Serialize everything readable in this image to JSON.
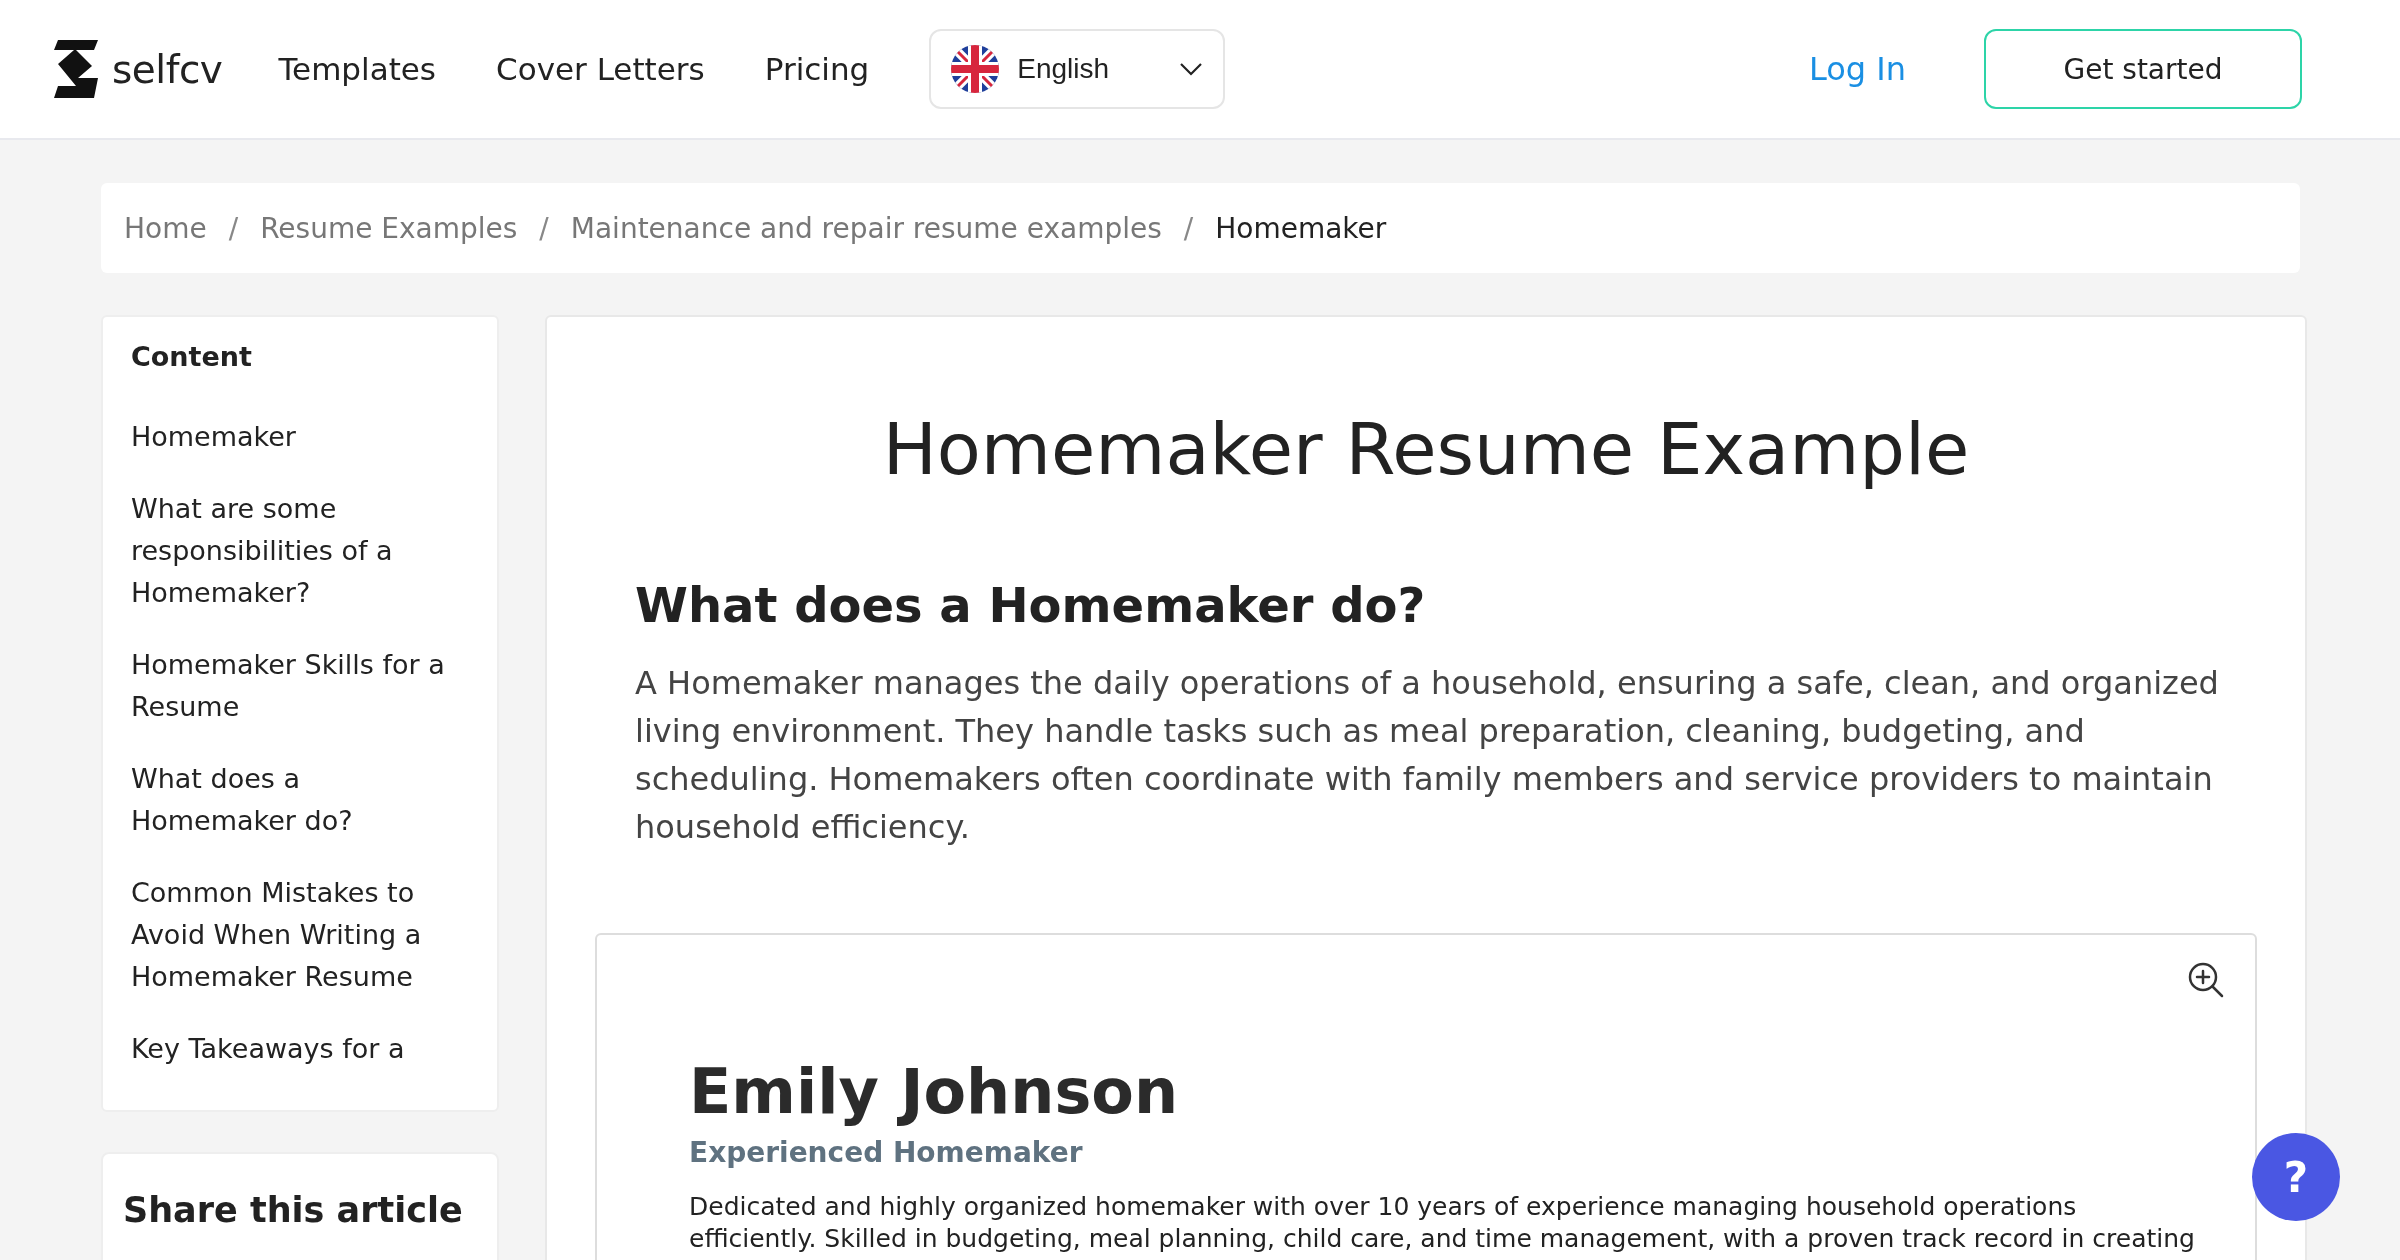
{
  "header": {
    "logo": "selfcv",
    "nav": [
      "Templates",
      "Cover Letters",
      "Pricing"
    ],
    "language": "English",
    "login": "Log In",
    "cta": "Get started"
  },
  "breadcrumb": {
    "separator": "/",
    "items": [
      "Home",
      "Resume Examples",
      "Maintenance and repair resume examples",
      "Homemaker"
    ]
  },
  "sidebar": {
    "title": "Content",
    "items": [
      "Homemaker",
      "What are some responsibilities of a Homemaker?",
      "Homemaker Skills for a Resume",
      "What does a Homemaker do?",
      "Common Mistakes to Avoid When Writing a Homemaker Resume",
      "Key Takeaways for a"
    ]
  },
  "share": {
    "title": "Share this article"
  },
  "article": {
    "title": "Homemaker Resume Example",
    "heading": "What does a Homemaker do?",
    "paragraph": "A Homemaker manages the daily operations of a household, ensuring a safe, clean, and organized living environment. They handle tasks such as meal preparation, cleaning, budgeting, and scheduling. Homemakers often coordinate with family members and service providers to maintain household efficiency."
  },
  "resume": {
    "name": "Emily Johnson",
    "role": "Experienced Homemaker",
    "summary": [
      "Dedicated and highly organized homemaker with over 10 years of experience managing household operations",
      "efficiently. Skilled in budgeting, meal planning, child care, and time management, with a proven track record in creating"
    ]
  },
  "help": "?"
}
